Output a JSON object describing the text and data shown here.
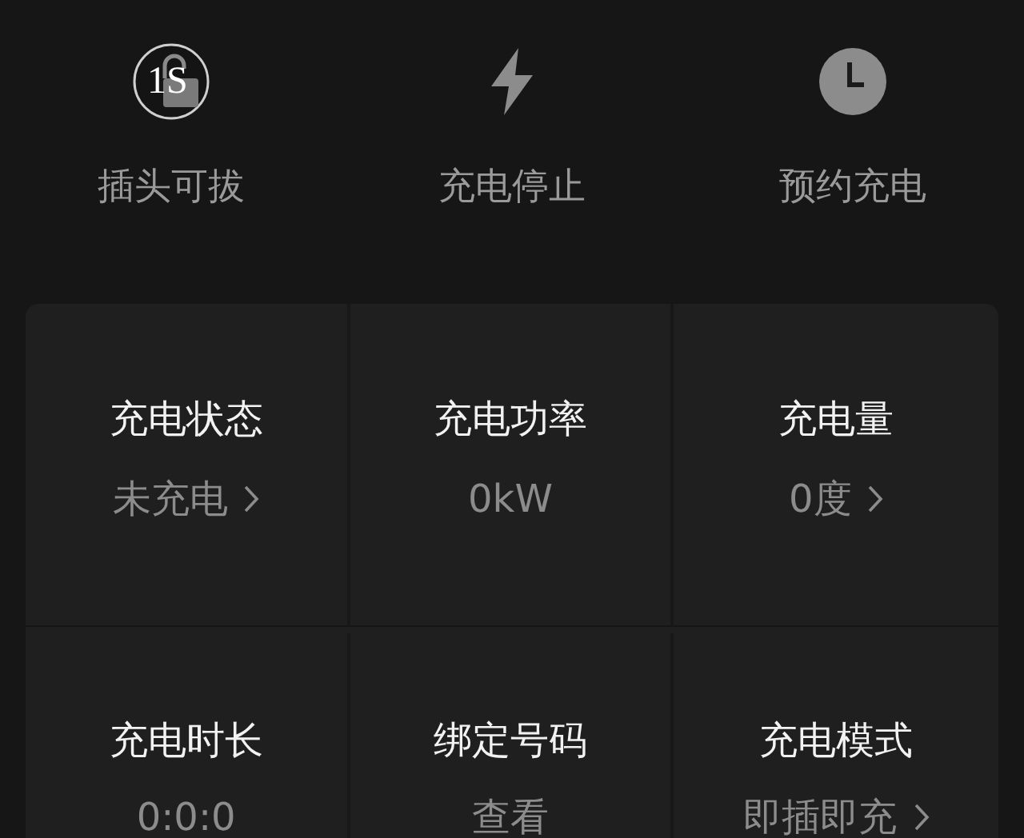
{
  "actions": [
    {
      "kind": "unlock",
      "label": "插头可拔",
      "badge": "1S"
    },
    {
      "kind": "bolt",
      "label": "充电停止"
    },
    {
      "kind": "clock",
      "label": "预约充电"
    }
  ],
  "stats": [
    {
      "title": "充电状态",
      "value": "未充电",
      "arrow": true
    },
    {
      "title": "充电功率",
      "value": "0kW",
      "arrow": false
    },
    {
      "title": "充电量",
      "value": "0度",
      "arrow": true
    },
    {
      "title": "充电时长",
      "value": "0:0:0",
      "arrow": false
    },
    {
      "title": "绑定号码",
      "value": "查看",
      "arrow": false
    },
    {
      "title": "充电模式",
      "value": "即插即充",
      "arrow": true
    }
  ]
}
